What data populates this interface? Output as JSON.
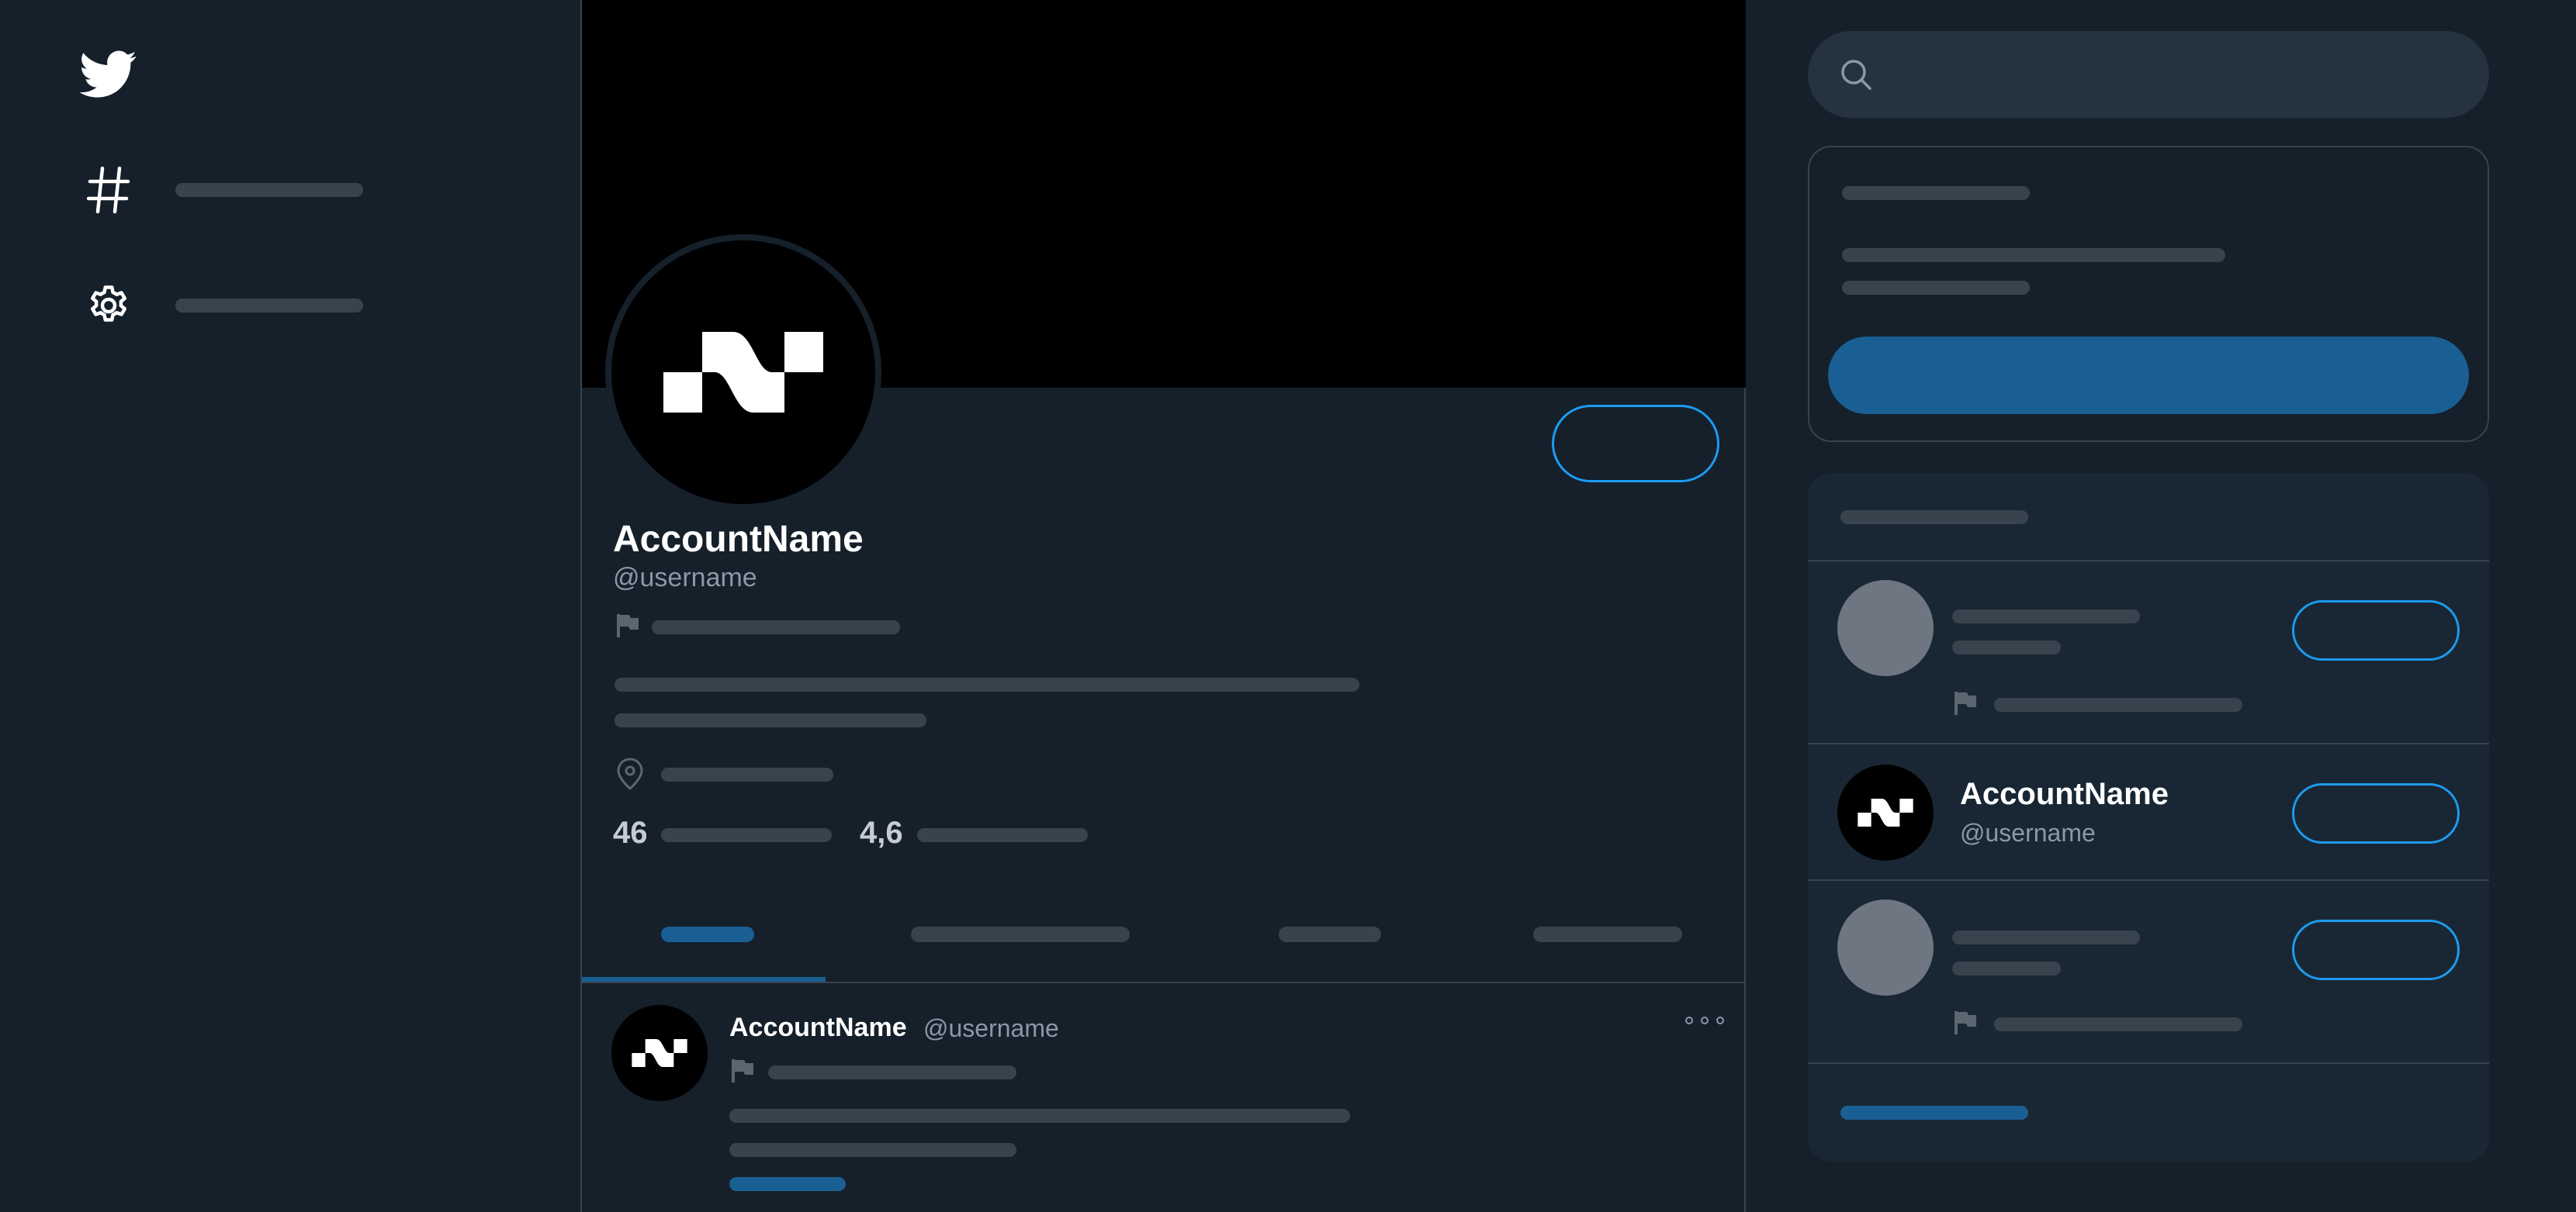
{
  "sidebar": {
    "icons": [
      "twitter-bird-icon",
      "hashtag-icon",
      "gear-icon"
    ]
  },
  "profile": {
    "name": "AccountName",
    "handle": "@username",
    "stats": {
      "following": "46",
      "followers": "4,6"
    }
  },
  "tweet": {
    "name": "AccountName",
    "handle": "@username"
  },
  "recommendation": {
    "name": "AccountName",
    "handle": "@username"
  },
  "colors": {
    "background": "#15202b",
    "placeholder": "#38444d",
    "accent": "#1d9bf0",
    "accent_dim": "#1a5f94"
  }
}
